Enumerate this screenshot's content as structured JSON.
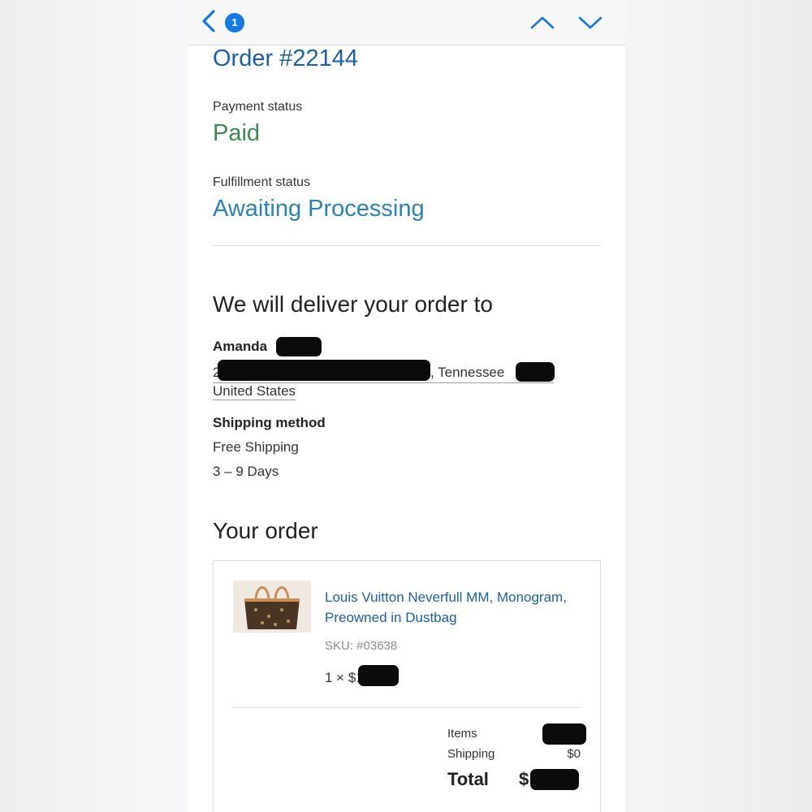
{
  "nav": {
    "back_icon": "chevron-left-icon",
    "badge_count": "1",
    "prev_icon": "chevron-up-icon",
    "next_icon": "chevron-down-icon"
  },
  "order": {
    "title": "Order #22144",
    "payment_status_label": "Payment status",
    "payment_status": "Paid",
    "fulfillment_status_label": "Fulfillment status",
    "fulfillment_status": "Awaiting Processing"
  },
  "delivery": {
    "heading": "We will deliver your order to",
    "name": "Amanda",
    "address_start": "2",
    "address_state": ", Tennessee",
    "country": "United States",
    "shipping_method_label": "Shipping method",
    "shipping_method": "Free Shipping",
    "shipping_time": "3 – 9 Days"
  },
  "your_order": {
    "heading": "Your order",
    "product_name": "Louis Vuitton Neverfull MM, Monogram, Preowned in Dustbag",
    "sku": "SKU: #03638",
    "quantity": "1 × $1",
    "summary": {
      "items_label": "Items",
      "shipping_label": "Shipping",
      "shipping_value": "$0",
      "total_label": "Total",
      "total_value": "$"
    }
  },
  "colors": {
    "link_blue": "#1d5fa8",
    "paid_green": "#3d8a4e",
    "processing_blue": "#2a82b8",
    "badge_blue": "#1479e5"
  }
}
